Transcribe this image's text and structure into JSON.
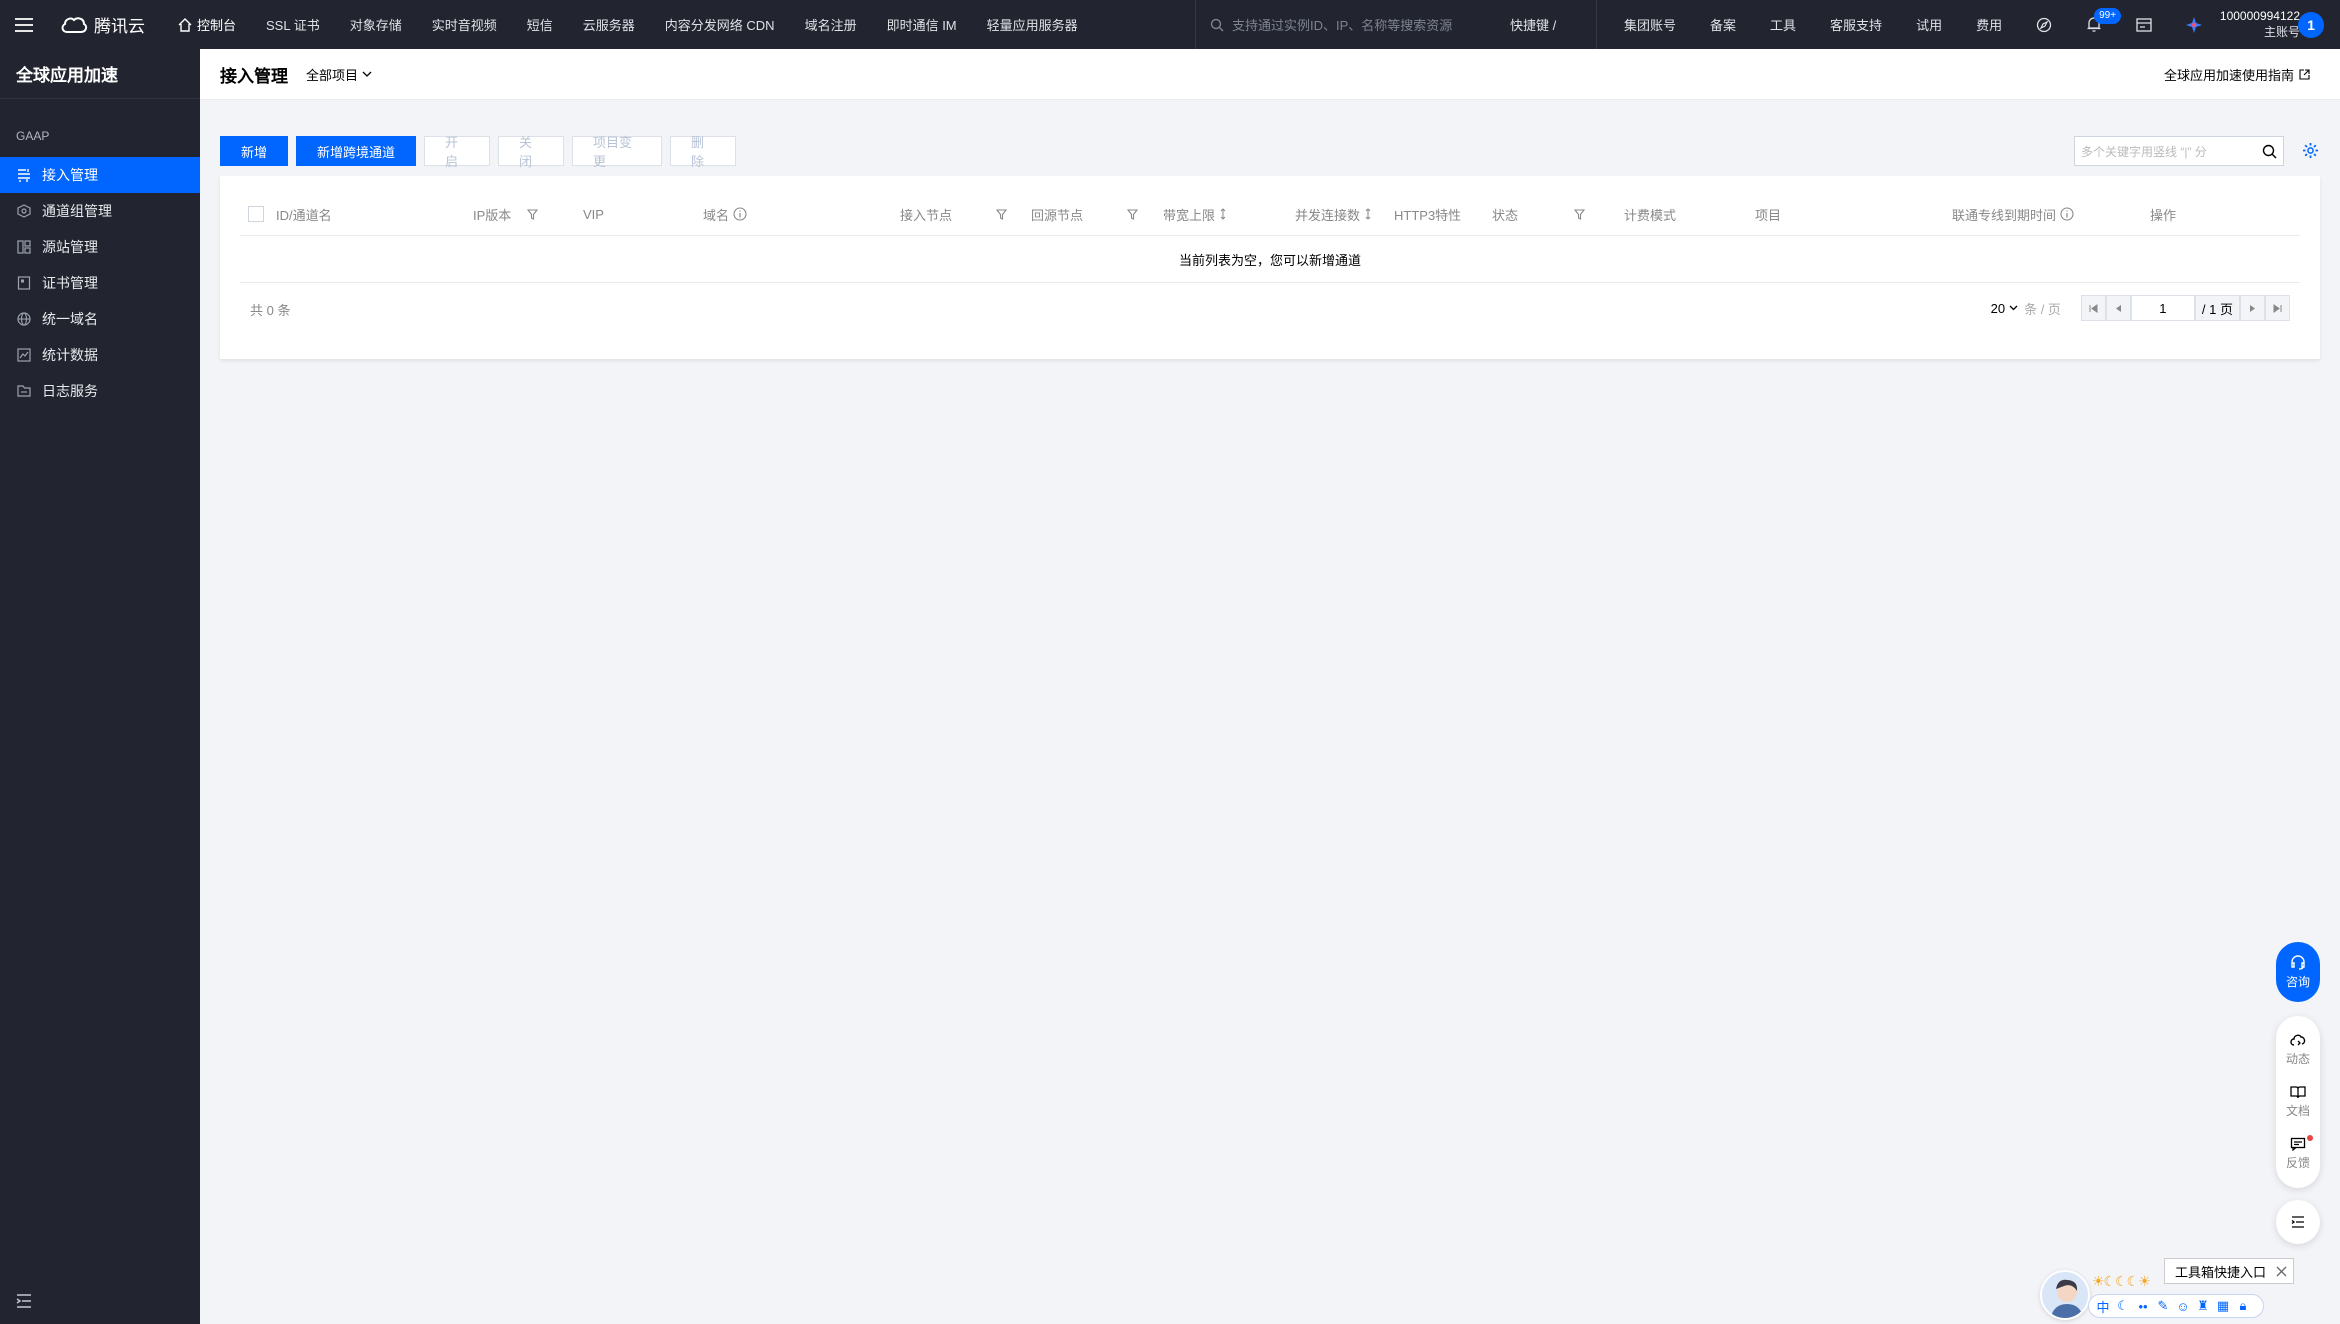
{
  "topbar": {
    "brand": "腾讯云",
    "nav": [
      "控制台",
      "SSL 证书",
      "对象存储",
      "实时音视频",
      "短信",
      "云服务器",
      "内容分发网络 CDN",
      "域名注册",
      "即时通信 IM",
      "轻量应用服务器"
    ],
    "search_placeholder": "支持通过实例ID、IP、名称等搜索资源",
    "shortcut": "快捷键 /",
    "right_nav": [
      "集团账号",
      "备案",
      "工具",
      "客服支持",
      "试用",
      "费用"
    ],
    "notification_badge": "99+",
    "account_id": "100000994122",
    "account_type": "主账号",
    "avatar_initial": "1"
  },
  "sidebar": {
    "title": "全球应用加速",
    "group": "GAAP",
    "items": [
      {
        "label": "接入管理",
        "icon": "access-icon",
        "active": true
      },
      {
        "label": "通道组管理",
        "icon": "channel-group-icon",
        "active": false
      },
      {
        "label": "源站管理",
        "icon": "origin-icon",
        "active": false
      },
      {
        "label": "证书管理",
        "icon": "certificate-icon",
        "active": false
      },
      {
        "label": "统一域名",
        "icon": "globe-icon",
        "active": false
      },
      {
        "label": "统计数据",
        "icon": "stats-icon",
        "active": false
      },
      {
        "label": "日志服务",
        "icon": "log-icon",
        "active": false
      }
    ]
  },
  "header": {
    "title": "接入管理",
    "project": "全部项目",
    "guide": "全球应用加速使用指南"
  },
  "toolbar": {
    "new": "新增",
    "new_cross": "新增跨境通道",
    "open": "开启",
    "close": "关闭",
    "project_change": "项目变更",
    "delete": "删除",
    "search_placeholder": "多个关键字用竖线 “|” 分"
  },
  "table": {
    "columns": [
      "ID/通道名",
      "IP版本",
      "VIP",
      "域名",
      "接入节点",
      "回源节点",
      "带宽上限",
      "并发连接数",
      "HTTP3特性",
      "状态",
      "计费模式",
      "项目",
      "联通专线到期时间",
      "操作"
    ],
    "empty_text": "当前列表为空，您可以新增通道",
    "total_text": "共 0 条",
    "page_size": "20",
    "page_size_unit": "条 / 页",
    "current_page": "1",
    "total_pages": "/ 1 页"
  },
  "float": {
    "consult": "咨询",
    "updates": "动态",
    "docs": "文档",
    "feedback": "反馈",
    "toolbox_tip": "工具箱快捷入口",
    "toolbox_lang": "中"
  },
  "colors": {
    "accent": "#0066ff",
    "nav_bg": "#222530"
  }
}
